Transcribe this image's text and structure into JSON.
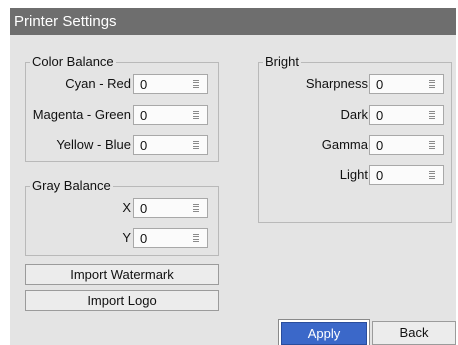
{
  "window": {
    "title": "Printer Settings"
  },
  "color_balance": {
    "title": "Color Balance",
    "rows": [
      {
        "label": "Cyan - Red",
        "value": "0"
      },
      {
        "label": "Magenta - Green",
        "value": "0"
      },
      {
        "label": "Yellow - Blue",
        "value": "0"
      }
    ]
  },
  "gray_balance": {
    "title": "Gray Balance",
    "rows": [
      {
        "label": "X",
        "value": "0"
      },
      {
        "label": "Y",
        "value": "0"
      }
    ]
  },
  "bright": {
    "title": "Bright",
    "rows": [
      {
        "label": "Sharpness",
        "value": "0"
      },
      {
        "label": "Dark",
        "value": "0"
      },
      {
        "label": "Gamma",
        "value": "0"
      },
      {
        "label": "Light",
        "value": "0"
      }
    ]
  },
  "buttons": {
    "import_watermark": "Import Watermark",
    "import_logo": "Import Logo",
    "apply": "Apply",
    "back": "Back"
  },
  "colors": {
    "titlebar": "#6e6e6e",
    "accent": "#3b68c9",
    "panel": "#e4e4e4"
  },
  "icons": {
    "spin_handle": "grip-lines-icon"
  }
}
